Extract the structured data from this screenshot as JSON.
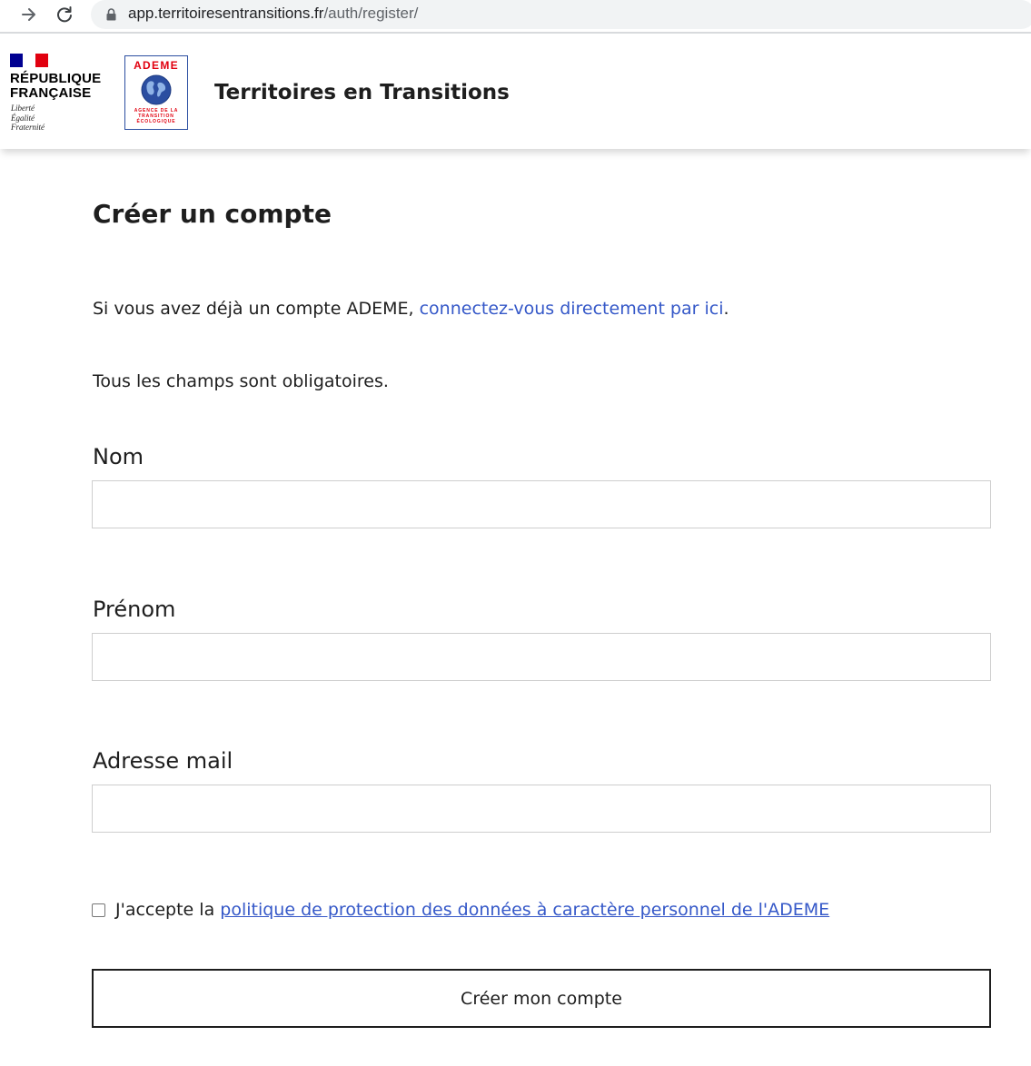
{
  "browser": {
    "url_host": "app.territoiresentransitions.fr",
    "url_path": "/auth/register/"
  },
  "header": {
    "republique_name": "RÉPUBLIQUE\nFRANÇAISE",
    "republique_motto": "Liberté\nÉgalité\nFraternité",
    "ademe_logo_word": "ADEME",
    "ademe_logo_subtitle": "AGENCE DE LA\nTRANSITION\nÉCOLOGIQUE",
    "service_title": "Territoires en Transitions"
  },
  "main": {
    "page_title": "Créer un compte",
    "intro_text": "Si vous avez déjà un compte ADEME, ",
    "intro_link": "connectez-vous directement par ici",
    "intro_end": ".",
    "required_note": "Tous les champs sont obligatoires.",
    "fields": [
      {
        "label": "Nom",
        "value": ""
      },
      {
        "label": "Prénom",
        "value": ""
      },
      {
        "label": "Adresse mail",
        "value": ""
      }
    ],
    "consent_prefix": "J'accepte la ",
    "consent_link": "politique de protection des données à caractère personnel de l'ADEME",
    "submit_label": "Créer mon compte"
  },
  "colors": {
    "link": "#3558c8",
    "flag_blue": "#000091",
    "flag_red": "#e1000f",
    "ademe_red": "#e1000f",
    "ademe_blue": "#2b4ea1"
  },
  "icons": [
    "arrow-forward-icon",
    "reload-icon",
    "lock-icon",
    "globe-icon"
  ]
}
